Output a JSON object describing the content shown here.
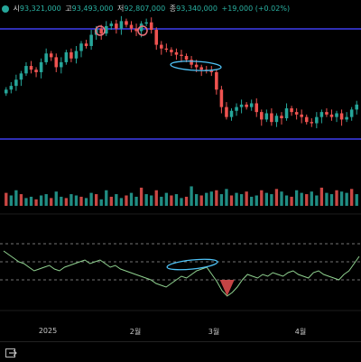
{
  "ohlc": {
    "open_label": "시",
    "open": "93,321,000",
    "high_label": "고",
    "high": "93,493,000",
    "low_label": "저",
    "low": "92,807,000",
    "close_label": "종",
    "close": "93,340,000",
    "change": "+19,000 (+0.02%)"
  },
  "x_ticks": [
    "2025",
    "2월",
    "3월",
    "4월"
  ],
  "colors": {
    "up": "#26a69a",
    "down": "#ef5350",
    "level_line": "#3d3df0",
    "annotation_circle": "#e8707a",
    "annotation_ellipse": "#4fc3f7",
    "oscillator": "#8fd18f",
    "oversold_fill": "#d84b4b"
  },
  "chart_data": [
    {
      "type": "candlestick",
      "x_ticks": [
        "2025",
        "2월",
        "3월",
        "4월"
      ],
      "close_path": [
        44,
        47,
        52,
        57,
        63,
        60,
        58,
        66,
        73,
        70,
        62,
        66,
        74,
        69,
        75,
        81,
        79,
        88,
        93,
        89,
        95,
        97,
        93,
        99,
        96,
        93,
        91,
        97,
        98,
        92,
        80,
        77,
        76,
        74,
        72,
        71,
        68,
        64,
        62,
        60,
        59,
        58,
        44,
        30,
        22,
        27,
        30,
        32,
        30,
        33,
        26,
        20,
        25,
        18,
        23,
        21,
        29,
        26,
        24,
        22,
        18,
        17,
        22,
        26,
        24,
        22,
        25,
        20,
        22,
        28,
        32
      ],
      "levels": [
        93.5,
        60
      ],
      "annotations": [
        "high-marker-1",
        "high-marker-2",
        "divergence-ellipse"
      ]
    },
    {
      "type": "bar",
      "name": "volume",
      "values": [
        10,
        8,
        12,
        9,
        6,
        7,
        5,
        8,
        9,
        6,
        11,
        7,
        6,
        9,
        8,
        7,
        6,
        10,
        9,
        5,
        12,
        7,
        9,
        6,
        8,
        10,
        7,
        14,
        9,
        8,
        12,
        7,
        10,
        8,
        9,
        6,
        7,
        15,
        9,
        8,
        10,
        11,
        12,
        9,
        13,
        8,
        10,
        9,
        11,
        7,
        8,
        12,
        10,
        9,
        13,
        11,
        8,
        7,
        12,
        10,
        9,
        11,
        8,
        14,
        10,
        9,
        12,
        11,
        10,
        13,
        9
      ]
    },
    {
      "type": "line",
      "name": "oscillator",
      "values": [
        62,
        58,
        54,
        50,
        48,
        44,
        40,
        42,
        44,
        46,
        42,
        40,
        44,
        46,
        48,
        50,
        52,
        48,
        50,
        52,
        48,
        44,
        46,
        42,
        40,
        38,
        36,
        34,
        32,
        30,
        26,
        24,
        22,
        26,
        30,
        34,
        32,
        36,
        40,
        42,
        44,
        36,
        28,
        18,
        12,
        16,
        22,
        30,
        36,
        34,
        32,
        36,
        34,
        38,
        36,
        34,
        38,
        40,
        36,
        34,
        32,
        38,
        40,
        36,
        34,
        32,
        30,
        36,
        40,
        48,
        56
      ],
      "levels": [
        70,
        50,
        30
      ]
    }
  ]
}
